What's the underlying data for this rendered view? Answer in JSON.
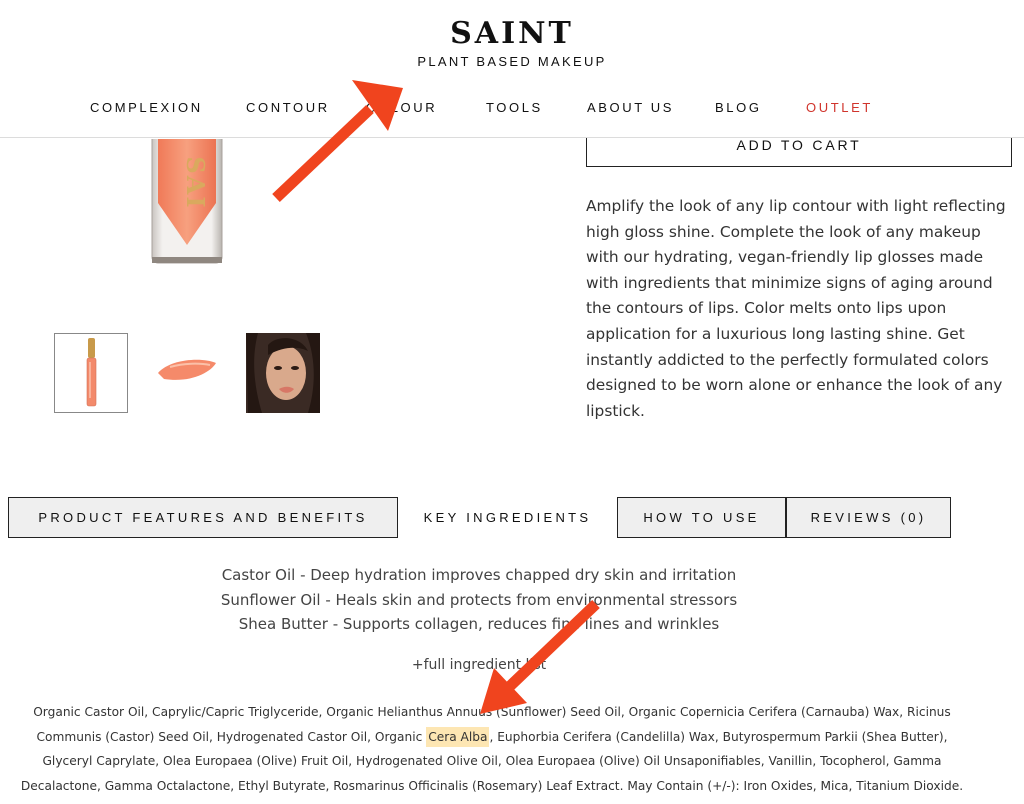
{
  "brand": {
    "name": "SAINT",
    "tagline": "PLANT BASED MAKEUP"
  },
  "nav": {
    "items": [
      {
        "label": "COMPLEXION"
      },
      {
        "label": "CONTOUR"
      },
      {
        "label": "COLOUR"
      },
      {
        "label": "TOOLS"
      },
      {
        "label": "ABOUT US"
      },
      {
        "label": "BLOG"
      },
      {
        "label": "OUTLET"
      }
    ],
    "outlet_color": "#d0342c"
  },
  "product": {
    "add_to_cart_label": "ADD TO CART",
    "description": "Amplify the look of any lip contour with light reflecting high gloss shine. Complete the look of any makeup with our hydrating, vegan-friendly lip glosses made with ingredients that minimize signs of aging around the contours of lips. Color melts onto lips upon application for a luxurious long lasting shine. Get instantly addicted to the perfectly formulated colors designed to be worn alone or enhance the look of any lipstick.",
    "gloss_color": "#f48c6c",
    "thumbnails": [
      {
        "icon": "lip-gloss-bottle-thumbnail",
        "selected": true
      },
      {
        "icon": "gloss-swatch-thumbnail",
        "selected": false
      },
      {
        "icon": "model-face-thumbnail",
        "selected": false
      }
    ]
  },
  "tabs": {
    "items": [
      {
        "label": "PRODUCT FEATURES AND BENEFITS",
        "active": false
      },
      {
        "label": "KEY INGREDIENTS",
        "active": true
      },
      {
        "label": "HOW TO USE",
        "active": false
      },
      {
        "label": "REVIEWS (0)",
        "active": false
      }
    ]
  },
  "key_ingredients": {
    "benefits": [
      "Castor Oil - Deep hydration improves chapped dry skin and irritation",
      "Sunflower Oil - Heals skin and protects from environmental stressors",
      "Shea Butter - Supports collagen, reduces fine lines and wrinkles"
    ],
    "full_list_toggle": "+full ingredient list",
    "full_list_before": "Organic Castor Oil, Caprylic/Capric Triglyceride, Organic Helianthus Annuus (Sunflower) Seed Oil, Organic Copernicia Cerifera (Carnauba) Wax, Ricinus Communis (Castor) Seed Oil, Hydrogenated Castor Oil, Organic ",
    "full_list_highlight": "Cera Alba",
    "full_list_after": ", Euphorbia Cerifera (Candelilla) Wax, Butyrospermum Parkii (Shea Butter), Glyceryl Caprylate, Olea Europaea (Olive) Fruit Oil, Hydrogenated Olive Oil, Olea Europaea (Olive) Oil Unsaponifiables, Vanillin, Tocopherol, Gamma Decalactone, Gamma Octalactone, Ethyl Butyrate, Rosmarinus Officinalis (Rosemary) Leaf Extract. May Contain (+/-): Iron Oxides, Mica, Titanium Dioxide.",
    "highlight_color": "#fde6b3"
  },
  "annotations": {
    "arrow_color": "#f0441e"
  }
}
